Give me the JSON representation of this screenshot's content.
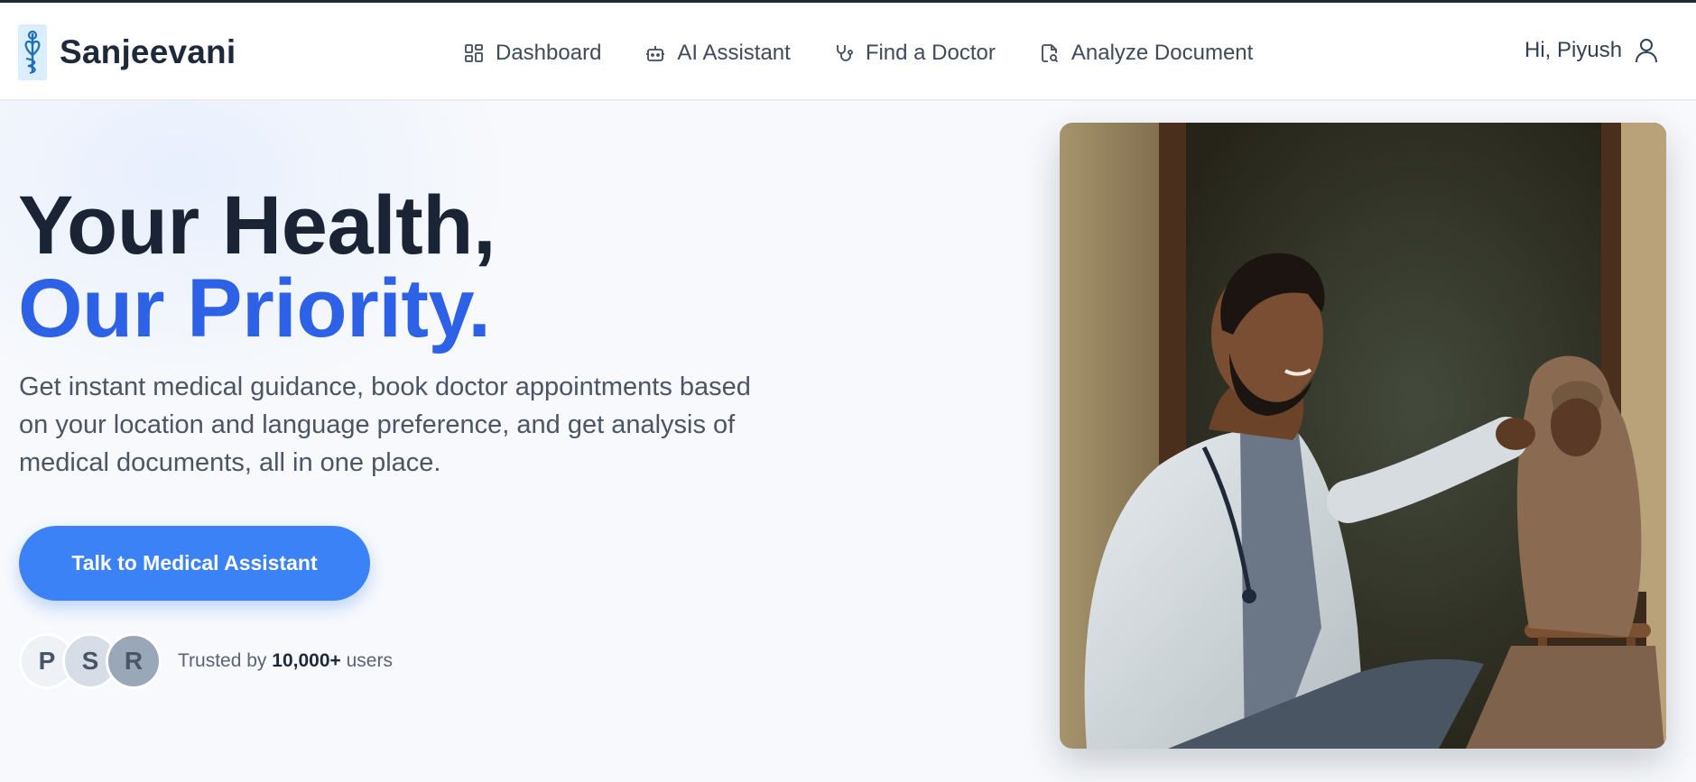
{
  "brand": {
    "name": "Sanjeevani",
    "logo_icon": "caduceus-heart-icon"
  },
  "nav": {
    "links": [
      {
        "label": "Dashboard",
        "icon": "grid-icon"
      },
      {
        "label": "AI Assistant",
        "icon": "robot-icon"
      },
      {
        "label": "Find a Doctor",
        "icon": "stethoscope-icon"
      },
      {
        "label": "Analyze Document",
        "icon": "document-scan-icon"
      }
    ],
    "greeting": "Hi, Piyush",
    "user_icon": "user-icon"
  },
  "hero": {
    "headline_line1": "Your Health,",
    "headline_line2": "Our Priority.",
    "subtext": "Get instant medical guidance, book doctor appointments based on your location and language preference, and get analysis of medical documents, all in one place.",
    "cta_label": "Talk to Medical Assistant",
    "trust": {
      "avatars": [
        "P",
        "S",
        "R"
      ],
      "prefix": "Trusted by",
      "count": "10,000+",
      "suffix": "users"
    },
    "image": "doctor-examining-child-photo"
  },
  "colors": {
    "accent": "#2e62e6",
    "cta": "#3b82f6",
    "heading": "#1b2434",
    "text": "#4b5566"
  }
}
